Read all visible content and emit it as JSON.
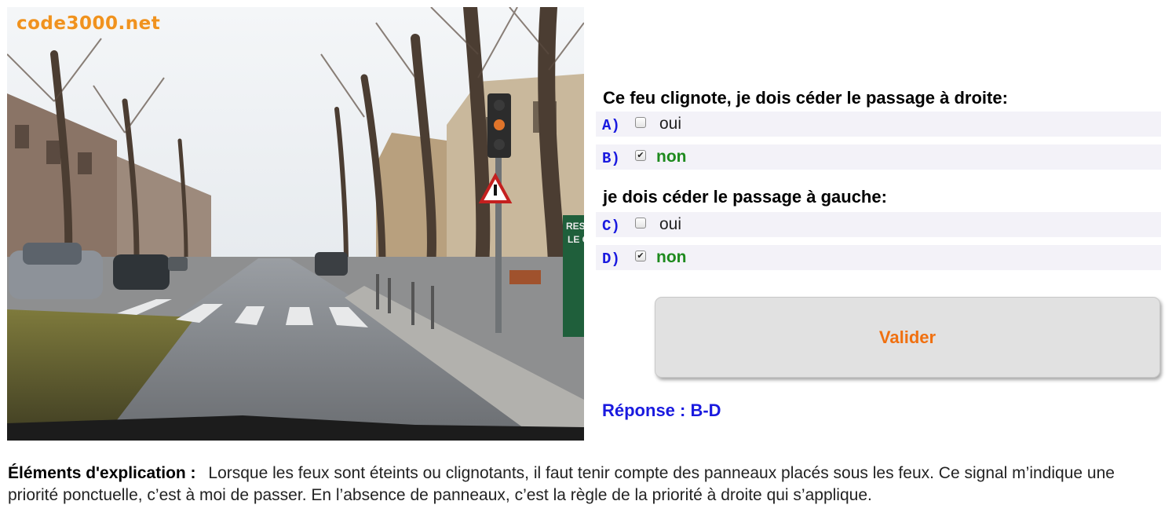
{
  "photo": {
    "watermark": "code3000.net",
    "sign_text": "RES LE C"
  },
  "question1": {
    "text": "Ce feu clignote, je dois céder le passage à droite:",
    "options": [
      {
        "letter": "A)",
        "label": "oui",
        "checked": false,
        "correct": false
      },
      {
        "letter": "B)",
        "label": "non",
        "checked": true,
        "correct": true
      }
    ]
  },
  "question2": {
    "text": "je dois céder le passage à gauche:",
    "options": [
      {
        "letter": "C)",
        "label": "oui",
        "checked": false,
        "correct": false
      },
      {
        "letter": "D)",
        "label": "non",
        "checked": true,
        "correct": true
      }
    ]
  },
  "validate_label": "Valider",
  "reponse": "Réponse : B-D",
  "explanation": {
    "label": "Éléments d'explication :",
    "text": "Lorsque les feux sont éteints ou clignotants, il faut tenir compte des panneaux placés sous les feux. Ce signal m’indique une priorité ponctuelle, c’est à moi de passer. En l’absence de panneaux, c’est la règle de la priorité à droite qui s’applique."
  },
  "colors": {
    "letter": "#1a1adf",
    "correct": "#1e8a1e",
    "validate_text": "#f07010",
    "watermark": "#f0921e",
    "row_bg": "#f3f2f8"
  },
  "icons": {
    "check": "✔"
  }
}
